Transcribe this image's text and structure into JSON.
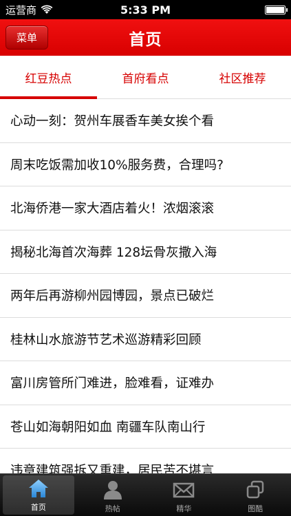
{
  "status": {
    "carrier": "运营商",
    "time": "5:33 PM"
  },
  "nav": {
    "menu_label": "菜单",
    "title": "首页"
  },
  "tabs": [
    {
      "label": "红豆热点",
      "active": true
    },
    {
      "label": "首府看点",
      "active": false
    },
    {
      "label": "社区推荐",
      "active": false
    }
  ],
  "news": [
    "心动一刻：贺州车展香车美女挨个看",
    "周末吃饭需加收10%服务费，合理吗?",
    "北海侨港一家大酒店着火！浓烟滚滚",
    "揭秘北海首次海葬 128坛骨灰撒入海",
    "两年后再游柳州园博园，景点已破烂",
    "桂林山水旅游节艺术巡游精彩回顾",
    "富川房管所门难进，脸难看，证难办",
    "苍山如海朝阳如血 南疆车队南山行",
    "违章建筑强拆又重建，居民苦不堪言"
  ],
  "bottom_tabs": [
    {
      "label": "首页",
      "icon": "home-icon"
    },
    {
      "label": "热帖",
      "icon": "person-icon"
    },
    {
      "label": "精华",
      "icon": "mail-icon"
    },
    {
      "label": "图酷",
      "icon": "gallery-icon"
    }
  ],
  "colors": {
    "accent": "#d60000",
    "nav_bg": "#e00000",
    "bottom_bg": "#111111"
  }
}
